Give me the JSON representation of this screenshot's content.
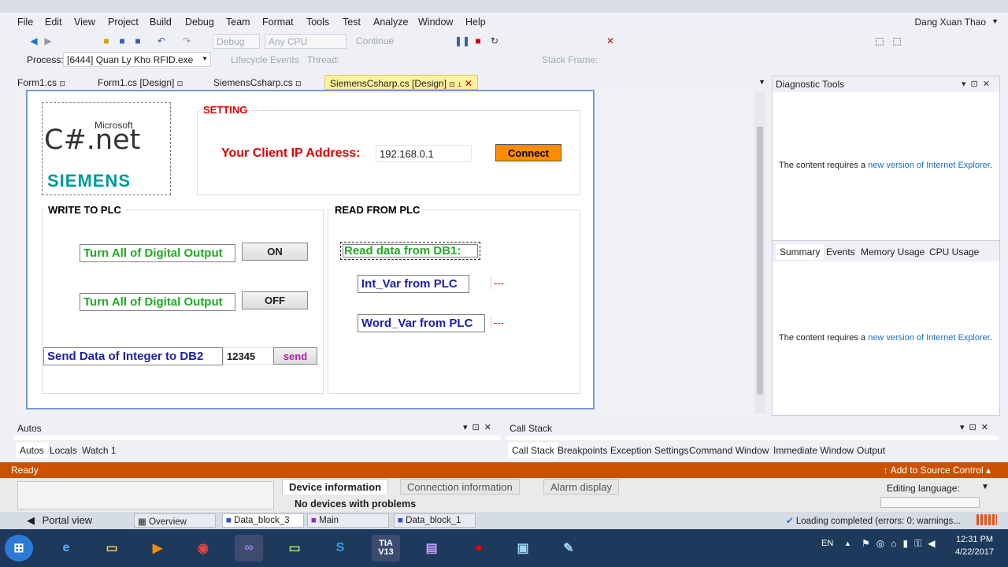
{
  "menu": [
    "File",
    "Edit",
    "View",
    "Project",
    "Build",
    "Debug",
    "Team",
    "Format",
    "Tools",
    "Test",
    "Analyze",
    "Window",
    "Help"
  ],
  "user": "Dang Xuan Thao",
  "toolbar": {
    "config": "Debug",
    "platform": "Any CPU",
    "continue": "Continue"
  },
  "process": {
    "label": "Process:",
    "value": "[6444] Quan Ly Kho RFID.exe",
    "lifecycle": "Lifecycle Events",
    "thread": "Thread:",
    "stack_frame": "Stack Frame:"
  },
  "tabs": [
    {
      "label": "Form1.cs"
    },
    {
      "label": "Form1.cs [Design]"
    },
    {
      "label": "SiemensCsharp.cs"
    },
    {
      "label": "SiemensCsharp.cs [Design]",
      "active": true
    }
  ],
  "form": {
    "logo": {
      "microsoft": "Microsoft",
      "csharp": "C#.net",
      "siemens": "SIEMENS"
    },
    "setting": {
      "title": "SETTING",
      "ip_label": "Your Client IP Address:",
      "ip_value": "192.168.0.1",
      "connect": "Connect"
    },
    "write": {
      "title": "WRITE TO PLC",
      "label1": "Turn All of Digital Output",
      "on": "ON",
      "label2": "Turn All of Digital Output",
      "off": "OFF",
      "send_label": "Send Data of Integer to DB2",
      "send_value": "12345",
      "send": "send"
    },
    "read": {
      "title": "READ FROM PLC",
      "db1": "Read data from DB1:",
      "int_var": "Int_Var from PLC",
      "int_val": "---",
      "word_var": "Word_Var from PLC",
      "word_val": "---"
    }
  },
  "diagnostic": {
    "title": "Diagnostic Tools",
    "msg_prefix": "The content requires a ",
    "msg_link": "new version of Internet Explorer",
    "msg_suffix": ".",
    "tabs": [
      "Summary",
      "Events",
      "Memory Usage",
      "CPU Usage"
    ]
  },
  "autos": {
    "title": "Autos",
    "tabs": [
      "Autos",
      "Locals",
      "Watch 1"
    ]
  },
  "callstack": {
    "title": "Call Stack",
    "tabs": [
      "Call Stack",
      "Breakpoints",
      "Exception Settings",
      "Command Window",
      "Immediate Window",
      "Output"
    ]
  },
  "status": {
    "left": "Ready",
    "right": "Add to Source Control"
  },
  "tia": {
    "tabs": [
      "Device information",
      "Connection information",
      "Alarm display"
    ],
    "no_devices": "No devices with problems",
    "editing_language": "Editing language:",
    "portal_view": "Portal view",
    "bottom_tabs": [
      "Overview",
      "Data_block_3",
      "Main",
      "Data_block_1"
    ],
    "loading": "Loading completed (errors: 0; warnings..."
  },
  "taskbar": {
    "lang": "EN",
    "time": "12:31 PM",
    "date": "4/22/2017",
    "tia_label": "TIA V13"
  },
  "colors": {
    "accent": "#ca5100",
    "link": "#1a6fc4",
    "red_text": "#e00000",
    "green_text": "#22aa22",
    "blue_text": "#1e1ea8",
    "connect": "#ff8c00"
  }
}
